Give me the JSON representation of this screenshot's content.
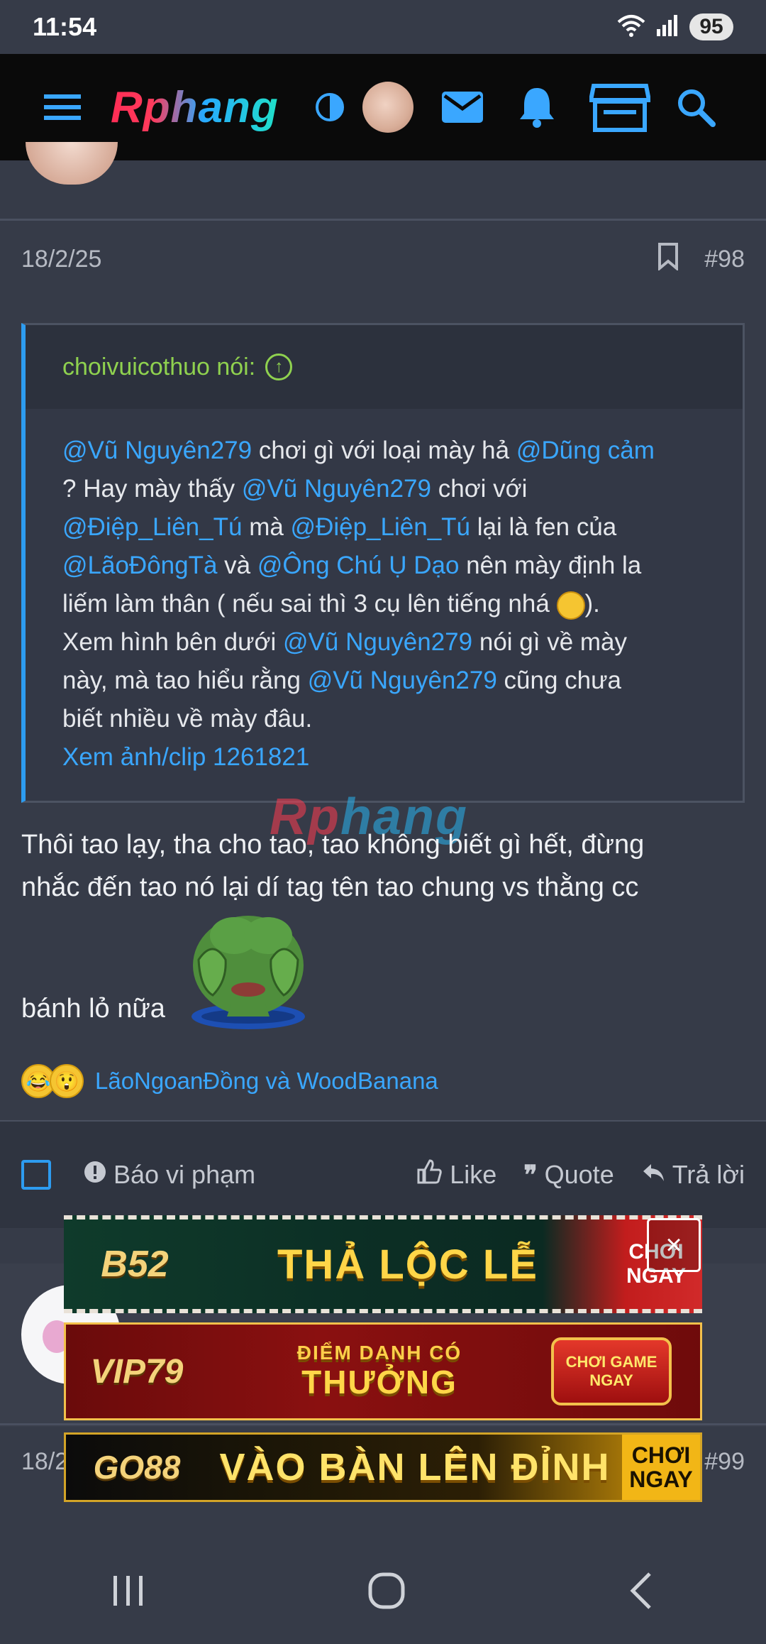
{
  "status_bar": {
    "time": "11:54",
    "battery": "95"
  },
  "header": {
    "logo": "Rphang"
  },
  "post": {
    "date": "18/2/25",
    "number": "#98",
    "quote": {
      "author": "choivuicothuo nói:",
      "lines": {
        "l1_m1": "@Vũ Nguyên279",
        "l1_t1": " chơi gì với loại mày hả ",
        "l1_m2": "@Dũng cảm",
        "l2_t1": "? Hay mày thấy ",
        "l2_m1": "@Vũ Nguyên279",
        "l2_t2": " chơi với",
        "l3_m1": "@Điệp_Liên_Tú",
        "l3_t1": " mà ",
        "l3_m2": "@Điệp_Liên_Tú",
        "l3_t2": " lại là fen của",
        "l4_m1": "@LãoĐôngTà",
        "l4_t1": " và ",
        "l4_m2": "@Ông Chú Ụ Dạo",
        "l4_t2": " nên mày định la",
        "l5_t1": "liếm làm thân ( nếu sai thì 3 cụ lên tiếng nhá ",
        "l5_t2": ").",
        "l6_t1": "Xem hình bên dưới ",
        "l6_m1": "@Vũ Nguyên279",
        "l6_t2": " nói gì về mày",
        "l7_t1": "này, mà tao hiểu rằng ",
        "l7_m1": "@Vũ Nguyên279",
        "l7_t2": " cũng chưa",
        "l8_t1": "biết nhiều về mày đâu.",
        "link": "Xem ảnh/clip 1261821"
      }
    },
    "reply": {
      "line1": "Thôi tao lạy, tha cho tao, tao không biết gì hết, đừng",
      "line2": "nhắc đến tao nó lại dí tag tên tao chung vs thằng cc",
      "line3": "bánh lỏ nữa"
    },
    "reactions": {
      "users": "LãoNgoanĐồng và WoodBanana"
    },
    "actions": {
      "report": "Báo vi phạm",
      "like": "Like",
      "quote": "Quote",
      "reply": "Trả lời"
    }
  },
  "next_post": {
    "date_partial": "18/2",
    "number": "#99"
  },
  "watermark": {
    "part1": "Rp",
    "part2": "hang"
  },
  "ads": [
    {
      "brand": "B52",
      "title": "THẢ LỘC LỄ",
      "cta_line1": "CHƠI",
      "cta_line2": "NGAY"
    },
    {
      "brand": "VIP79",
      "subtitle": "ĐIỂM DANH CÓ",
      "title": "THƯỞNG",
      "cta_line1": "CHƠI GAME",
      "cta_line2": "NGAY"
    },
    {
      "brand": "GO88",
      "title": "VÀO BÀN LÊN ĐỈNH",
      "cta_line1": "CHƠI",
      "cta_line2": "NGAY"
    }
  ],
  "colors": {
    "accent": "#2d9cf0",
    "mention": "#3aa7ff",
    "quote_author": "#8fd14f",
    "background": "#363b48"
  }
}
